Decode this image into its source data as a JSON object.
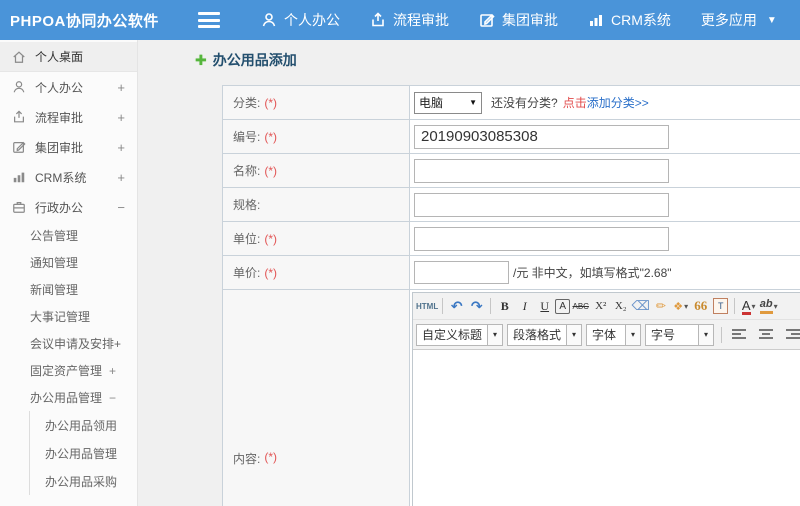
{
  "header": {
    "brand": "PHPOA协同办公软件",
    "nav": [
      {
        "label": "个人办公",
        "icon": "person-icon"
      },
      {
        "label": "流程审批",
        "icon": "share-icon"
      },
      {
        "label": "集团审批",
        "icon": "edit-icon"
      },
      {
        "label": "CRM系统",
        "icon": "chart-icon"
      },
      {
        "label": "更多应用",
        "icon": "caret-down-icon"
      }
    ]
  },
  "sidebar": {
    "items": [
      {
        "label": "个人桌面",
        "icon": "home-icon",
        "expander": ""
      },
      {
        "label": "个人办公",
        "icon": "person-icon",
        "expander": "+"
      },
      {
        "label": "流程审批",
        "icon": "share-icon",
        "expander": "+"
      },
      {
        "label": "集团审批",
        "icon": "edit-icon",
        "expander": "+"
      },
      {
        "label": "CRM系统",
        "icon": "chart-icon",
        "expander": "+"
      },
      {
        "label": "行政办公",
        "icon": "briefcase-icon",
        "expander": "−"
      }
    ],
    "sub_items": [
      {
        "label": "公告管理",
        "expander": ""
      },
      {
        "label": "通知管理",
        "expander": ""
      },
      {
        "label": "新闻管理",
        "expander": ""
      },
      {
        "label": "大事记管理",
        "expander": ""
      },
      {
        "label": "会议申请及安排+",
        "expander": ""
      },
      {
        "label": "固定资产管理",
        "expander": "+"
      },
      {
        "label": "办公用品管理",
        "expander": "−"
      }
    ],
    "sub_sub_items": [
      {
        "label": "办公用品领用"
      },
      {
        "label": "办公用品管理"
      },
      {
        "label": "办公用品采购"
      }
    ]
  },
  "main": {
    "title": "办公用品添加",
    "form": {
      "category_label": "分类:",
      "category_required": "(*)",
      "category_value": "电脑",
      "category_hint": "还没有分类?",
      "category_link_red": "点击",
      "category_link_blue": "添加分类>>",
      "code_label": "编号:",
      "code_required": "(*)",
      "code_value": "20190903085308",
      "name_label": "名称:",
      "name_required": "(*)",
      "spec_label": "规格:",
      "unit_label": "单位:",
      "unit_required": "(*)",
      "price_label": "单价:",
      "price_required": "(*)",
      "price_note": "/元 非中文，如填写格式\"2.68\"",
      "content_label": "内容:",
      "content_required": "(*)"
    },
    "editor": {
      "source_button": "HTML",
      "undo": "↶",
      "redo": "↷",
      "bold": "B",
      "italic": "I",
      "underline": "U",
      "box_a": "A",
      "strike": "ABC",
      "superscript": "X²",
      "subscript": "X₂",
      "eraser": "⌫",
      "brush": "✏",
      "wand": "❖",
      "quote": "66",
      "paste_t": "T",
      "font_color": "A",
      "highlight": "ab",
      "caret": "▾",
      "select_caret": "▼",
      "dropdowns": [
        {
          "label": "自定义标题"
        },
        {
          "label": "段落格式"
        },
        {
          "label": "字体"
        },
        {
          "label": "字号"
        }
      ]
    }
  }
}
